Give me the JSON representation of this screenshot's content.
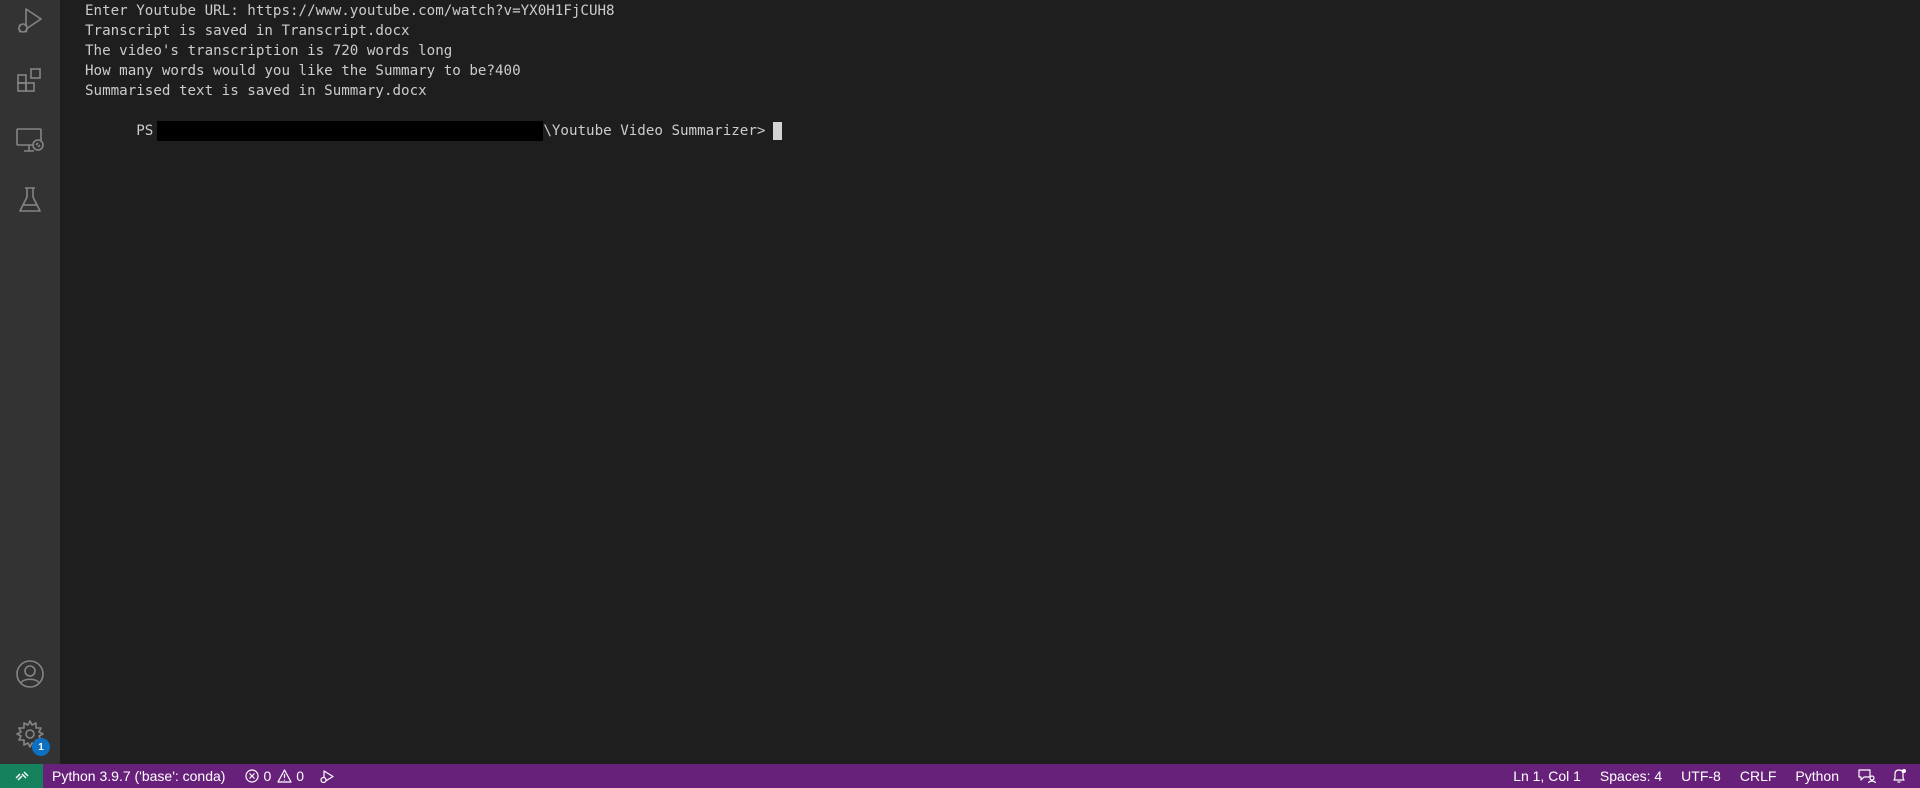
{
  "terminal": {
    "lines": [
      "Enter Youtube URL: https://www.youtube.com/watch?v=YX0H1FjCUH8",
      "Transcript is saved in Transcript.docx",
      "The video's transcription is 720 words long",
      "How many words would you like the Summary to be?400",
      "Summarised text is saved in Summary.docx"
    ],
    "prompt_prefix": "PS",
    "prompt_path": "\\Youtube Video Summarizer>"
  },
  "activity_bar": {
    "icons": [
      "run-debug-icon",
      "extensions-icon",
      "remote-explorer-icon",
      "testing-icon",
      "accounts-icon",
      "manage-gear-icon"
    ],
    "manage_badge": "1"
  },
  "status_bar": {
    "interpreter": "Python 3.9.7 ('base': conda)",
    "errors": "0",
    "warnings": "0",
    "position": "Ln 1, Col 1",
    "spaces": "Spaces: 4",
    "encoding": "UTF-8",
    "eol": "CRLF",
    "language": "Python"
  },
  "colors": {
    "editor_bg": "#1e1e1e",
    "activity_bar_bg": "#333333",
    "status_bar_bg": "#68217a",
    "remote_bg": "#16825d",
    "badge_bg": "#0e70c0",
    "icon_color": "#858585"
  }
}
